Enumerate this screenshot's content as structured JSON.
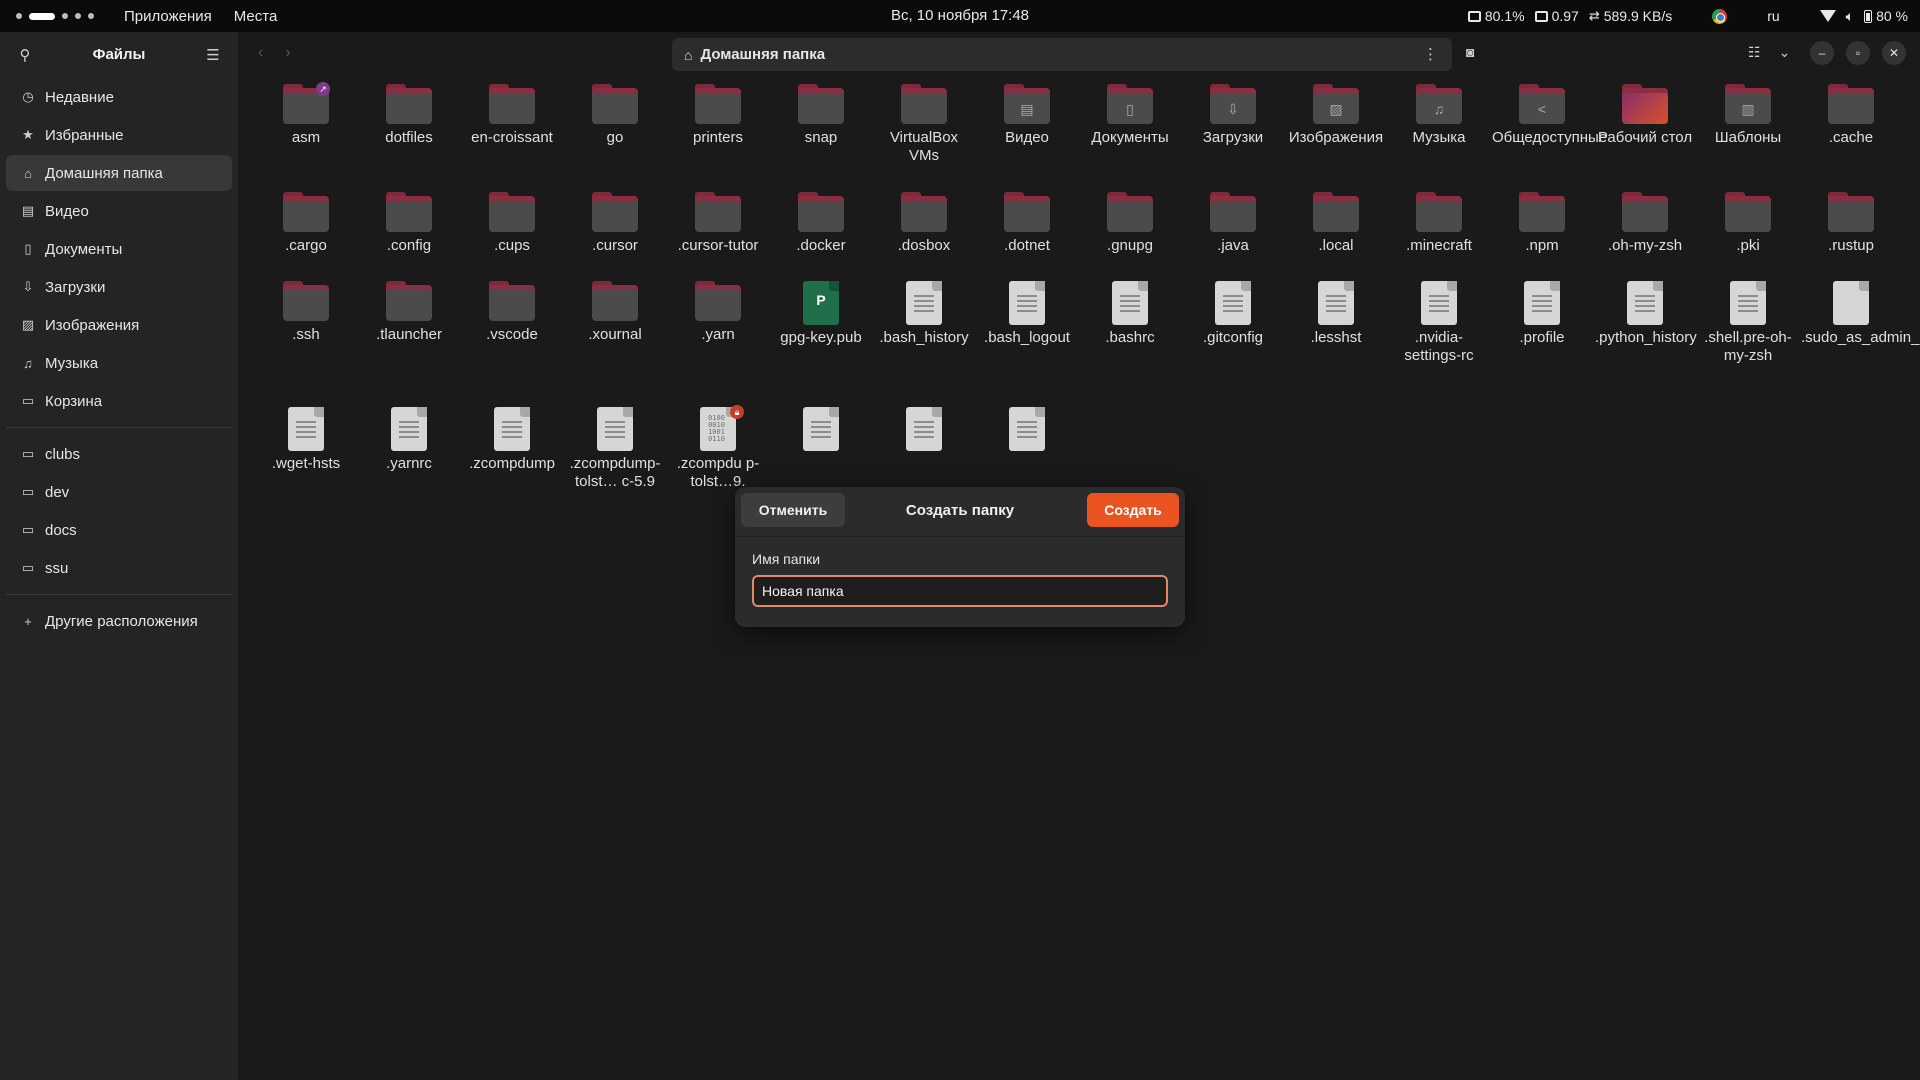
{
  "topbar": {
    "menu": [
      "Приложения",
      "Места"
    ],
    "clock": "Вс, 10 ноября  17:48",
    "cpu": "80.1%",
    "load": "0.97",
    "net": "589.9 KB/s",
    "lang": "ru",
    "battery": "80 %"
  },
  "sidebar": {
    "title": "Файлы",
    "places": [
      {
        "label": "Недавние",
        "icon": "clock-icon"
      },
      {
        "label": "Избранные",
        "icon": "star-icon"
      },
      {
        "label": "Домашняя папка",
        "icon": "home-icon",
        "active": true
      },
      {
        "label": "Видео",
        "icon": "video-icon"
      },
      {
        "label": "Документы",
        "icon": "document-icon"
      },
      {
        "label": "Загрузки",
        "icon": "download-icon"
      },
      {
        "label": "Изображения",
        "icon": "image-icon"
      },
      {
        "label": "Музыка",
        "icon": "music-icon"
      },
      {
        "label": "Корзина",
        "icon": "trash-icon"
      }
    ],
    "bookmarks": [
      {
        "label": "clubs",
        "icon": "folder-icon"
      },
      {
        "label": "dev",
        "icon": "folder-icon"
      },
      {
        "label": "docs",
        "icon": "folder-icon"
      },
      {
        "label": "ssu",
        "icon": "folder-icon"
      }
    ],
    "other": "Другие расположения"
  },
  "path": {
    "location": "Домашняя папка"
  },
  "items": [
    {
      "name": "asm",
      "kind": "folder",
      "badge": "link"
    },
    {
      "name": "dotfiles",
      "kind": "folder"
    },
    {
      "name": "en-croissant",
      "kind": "folder"
    },
    {
      "name": "go",
      "kind": "folder"
    },
    {
      "name": "printers",
      "kind": "folder"
    },
    {
      "name": "snap",
      "kind": "folder"
    },
    {
      "name": "VirtualBox VMs",
      "kind": "folder"
    },
    {
      "name": "Видео",
      "kind": "folder",
      "glyph": "▤"
    },
    {
      "name": "Документы",
      "kind": "folder",
      "glyph": "▯"
    },
    {
      "name": "Загрузки",
      "kind": "folder",
      "glyph": "⇩"
    },
    {
      "name": "Изображения",
      "kind": "folder",
      "glyph": "▨"
    },
    {
      "name": "Музыка",
      "kind": "folder",
      "glyph": "♫"
    },
    {
      "name": "Общедоступные",
      "kind": "folder",
      "glyph": "<"
    },
    {
      "name": "Рабочий стол",
      "kind": "desktop"
    },
    {
      "name": "Шаблоны",
      "kind": "folder",
      "glyph": "▥"
    },
    {
      "name": ".cache",
      "kind": "folder"
    },
    {
      "name": ".cargo",
      "kind": "folder"
    },
    {
      "name": ".config",
      "kind": "folder"
    },
    {
      "name": ".cups",
      "kind": "folder"
    },
    {
      "name": ".cursor",
      "kind": "folder"
    },
    {
      "name": ".cursor-tutor",
      "kind": "folder"
    },
    {
      "name": ".docker",
      "kind": "folder"
    },
    {
      "name": ".dosbox",
      "kind": "folder"
    },
    {
      "name": ".dotnet",
      "kind": "folder"
    },
    {
      "name": ".gnupg",
      "kind": "folder"
    },
    {
      "name": ".java",
      "kind": "folder"
    },
    {
      "name": ".local",
      "kind": "folder"
    },
    {
      "name": ".minecraft",
      "kind": "folder"
    },
    {
      "name": ".npm",
      "kind": "folder"
    },
    {
      "name": ".oh-my-zsh",
      "kind": "folder"
    },
    {
      "name": ".pki",
      "kind": "folder"
    },
    {
      "name": ".rustup",
      "kind": "folder"
    },
    {
      "name": ".ssh",
      "kind": "folder"
    },
    {
      "name": ".tlauncher",
      "kind": "folder"
    },
    {
      "name": ".vscode",
      "kind": "folder"
    },
    {
      "name": ".xournal",
      "kind": "folder"
    },
    {
      "name": ".yarn",
      "kind": "folder"
    },
    {
      "name": "gpg-key.pub",
      "kind": "key"
    },
    {
      "name": ".bash_history",
      "kind": "text"
    },
    {
      "name": ".bash_logout",
      "kind": "text"
    },
    {
      "name": ".bashrc",
      "kind": "text"
    },
    {
      "name": ".gitconfig",
      "kind": "text"
    },
    {
      "name": ".lesshst",
      "kind": "text"
    },
    {
      "name": ".nvidia-settings-rc",
      "kind": "text"
    },
    {
      "name": ".profile",
      "kind": "text"
    },
    {
      "name": ".python_history",
      "kind": "text"
    },
    {
      "name": ".shell.pre-oh-my-zsh",
      "kind": "text"
    },
    {
      "name": ".sudo_as_admin_successful",
      "kind": "blank"
    },
    {
      "name": ".wget-hsts",
      "kind": "text"
    },
    {
      "name": ".yarnrc",
      "kind": "text"
    },
    {
      "name": ".zcompdump",
      "kind": "text"
    },
    {
      "name": ".zcompdump-tolst… c-5.9",
      "kind": "text"
    },
    {
      "name": ".zcompdu p-tolst…9.",
      "kind": "binary",
      "badge": "lock"
    },
    {
      "name": "",
      "kind": "text"
    },
    {
      "name": "",
      "kind": "text"
    },
    {
      "name": "",
      "kind": "text"
    }
  ],
  "dialog": {
    "cancel": "Отменить",
    "title": "Создать папку",
    "create": "Создать",
    "label": "Имя папки",
    "value": "Новая папка"
  }
}
